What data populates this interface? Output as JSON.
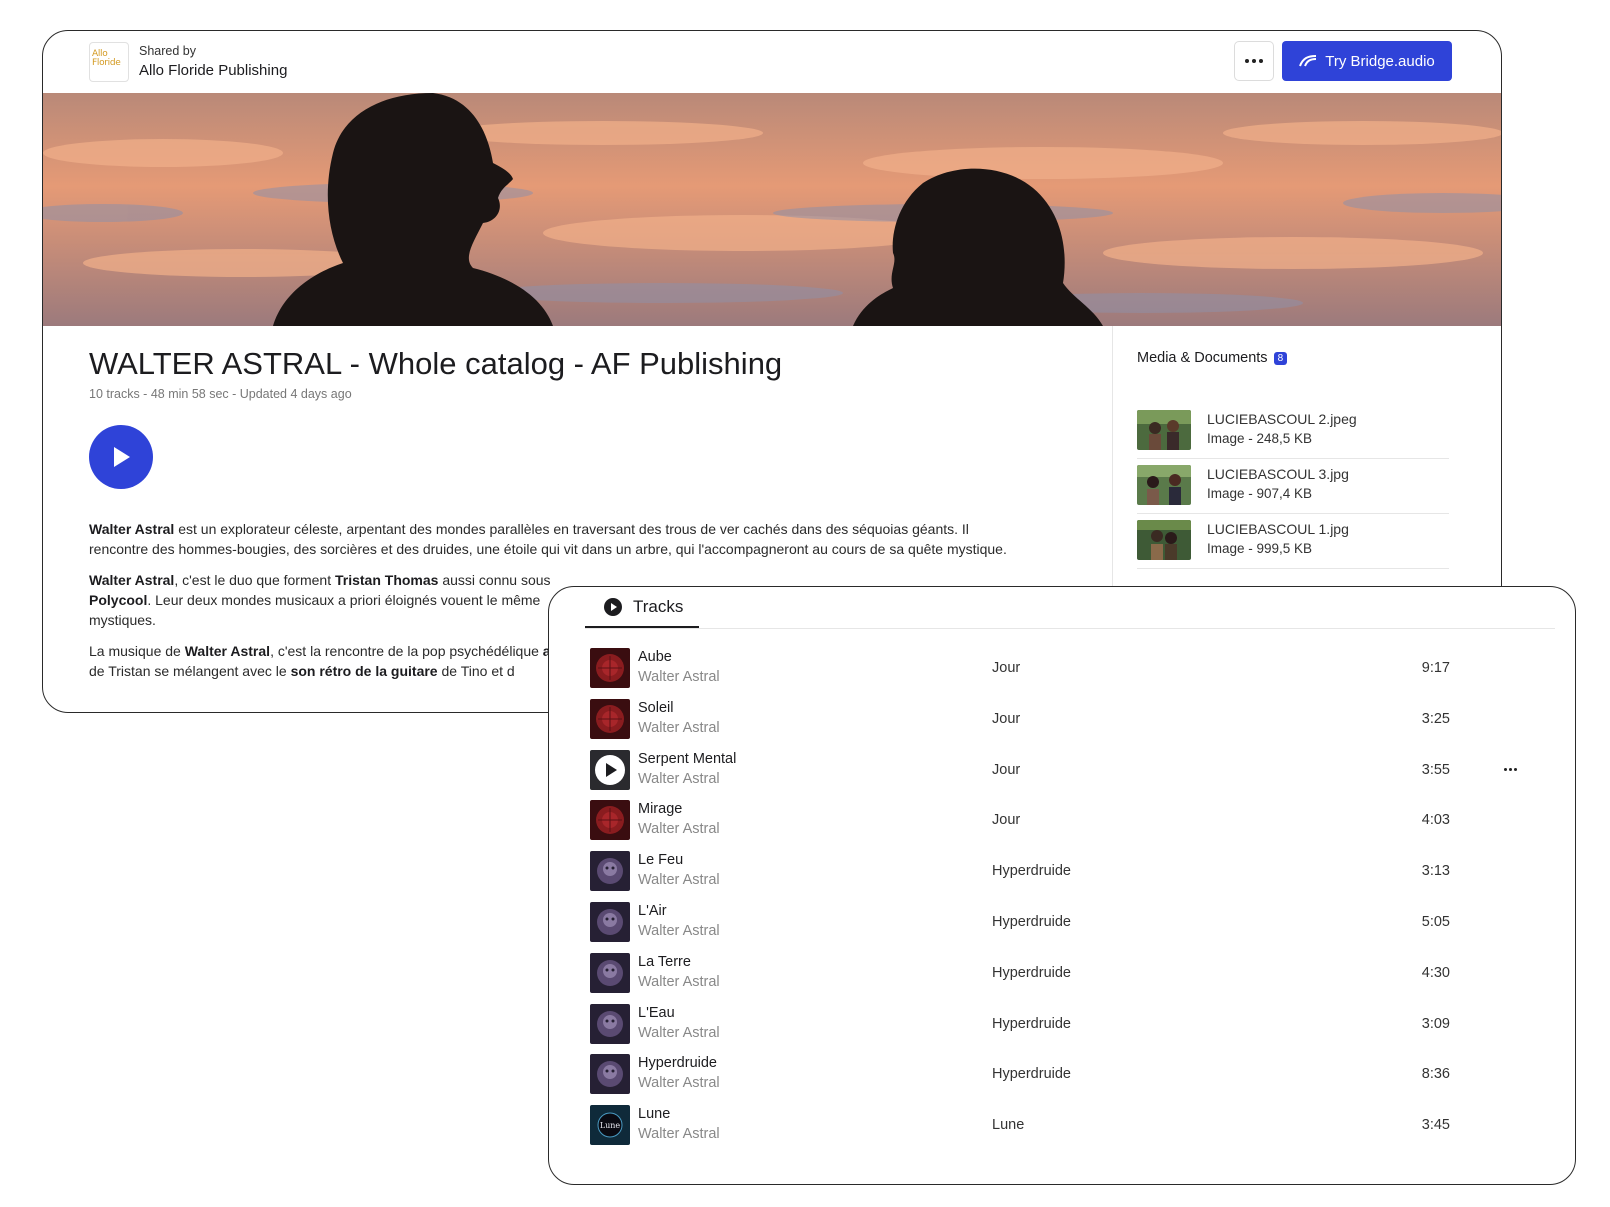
{
  "header": {
    "shared_by_label": "Shared by",
    "publisher_name": "Allo Floride Publishing",
    "logo_text": "Allo Floride",
    "cta_label": "Try Bridge.audio"
  },
  "playlist": {
    "title": "WALTER ASTRAL - Whole catalog - AF Publishing",
    "meta": "10 tracks - 48 min 58 sec - Updated 4 days ago"
  },
  "description": {
    "p1": [
      {
        "b": "Walter Astral"
      },
      {
        "t": " est un explorateur céleste, arpentant des mondes parallèles en traversant des trous de ver cachés dans des séquoias géants. Il rencontre des hommes-bougies, des sorcières et des druides, une étoile qui vit dans un arbre, qui l'accompagneront au cours de sa quête mystique."
      }
    ],
    "p2": [
      {
        "b": "Walter Astral"
      },
      {
        "t": ", c'est le duo que forment "
      },
      {
        "b": "Tristan Thomas"
      },
      {
        "t": " aussi connu sous "
      },
      {
        "b": "Polycool"
      },
      {
        "t": ". Leur deux mondes musicaux a priori éloignés vouent le même mystiques."
      }
    ],
    "p3": [
      {
        "t": "La musique de "
      },
      {
        "b": "Walter Astral"
      },
      {
        "t": ", c'est la rencontre de la pop psychédélique "
      },
      {
        "b": "acid"
      },
      {
        "t": " de Tristan se mélangent avec le "
      },
      {
        "b": "son rétro de la guitare"
      },
      {
        "t": " de Tino et d"
      }
    ]
  },
  "media": {
    "title": "Media & Documents",
    "count": "8",
    "items": [
      {
        "name": "LUCIEBASCOUL 2.jpeg",
        "info": "Image - 248,5 KB"
      },
      {
        "name": "LUCIEBASCOUL 3.jpg",
        "info": "Image - 907,4 KB"
      },
      {
        "name": "LUCIEBASCOUL 1.jpg",
        "info": "Image - 999,5 KB"
      }
    ]
  },
  "tracks": {
    "tab_label": "Tracks",
    "items": [
      {
        "title": "Aube",
        "artist": "Walter Astral",
        "album": "Jour",
        "duration": "9:17",
        "cover": "red"
      },
      {
        "title": "Soleil",
        "artist": "Walter Astral",
        "album": "Jour",
        "duration": "3:25",
        "cover": "red"
      },
      {
        "title": "Serpent Mental",
        "artist": "Walter Astral",
        "album": "Jour",
        "duration": "3:55",
        "cover": "play"
      },
      {
        "title": "Mirage",
        "artist": "Walter Astral",
        "album": "Jour",
        "duration": "4:03",
        "cover": "red"
      },
      {
        "title": "Le Feu",
        "artist": "Walter Astral",
        "album": "Hyperdruide",
        "duration": "3:13",
        "cover": "purple"
      },
      {
        "title": "L'Air",
        "artist": "Walter Astral",
        "album": "Hyperdruide",
        "duration": "5:05",
        "cover": "purple"
      },
      {
        "title": "La Terre",
        "artist": "Walter Astral",
        "album": "Hyperdruide",
        "duration": "4:30",
        "cover": "purple"
      },
      {
        "title": "L'Eau",
        "artist": "Walter Astral",
        "album": "Hyperdruide",
        "duration": "3:09",
        "cover": "purple"
      },
      {
        "title": "Hyperdruide",
        "artist": "Walter Astral",
        "album": "Hyperdruide",
        "duration": "8:36",
        "cover": "purple"
      },
      {
        "title": "Lune",
        "artist": "Walter Astral",
        "album": "Lune",
        "duration": "3:45",
        "cover": "lune"
      }
    ]
  },
  "colors": {
    "accent": "#2f43d8",
    "text": "#1c1c1f",
    "muted": "#888888"
  }
}
